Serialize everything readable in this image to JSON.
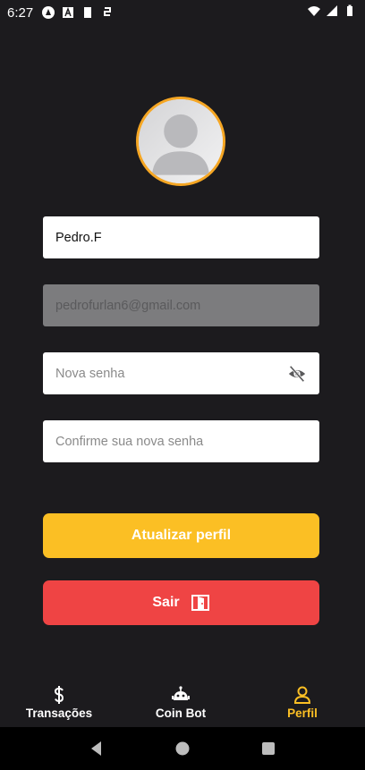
{
  "status_bar": {
    "time": "6:27"
  },
  "profile": {
    "avatar_icon": "user-placeholder-icon",
    "name_value": "Pedro.F",
    "email_value": "pedrofurlan6@gmail.com",
    "new_password_placeholder": "Nova senha",
    "confirm_password_placeholder": "Confirme sua nova senha",
    "password_visibility_icon": "eye-off-icon"
  },
  "actions": {
    "update_label": "Atualizar perfil",
    "logout_label": "Sair",
    "logout_icon": "door-exit-icon"
  },
  "bottom_nav": {
    "items": [
      {
        "label": "Transações",
        "icon": "dollar-icon",
        "active": false
      },
      {
        "label": "Coin Bot",
        "icon": "robot-icon",
        "active": false
      },
      {
        "label": "Perfil",
        "icon": "person-icon",
        "active": true
      }
    ]
  },
  "colors": {
    "background": "#1c1b1e",
    "accent": "#fbbf24",
    "avatar_ring": "#f5a623",
    "danger": "#ef4444",
    "disabled_field": "#7c7c7e"
  }
}
